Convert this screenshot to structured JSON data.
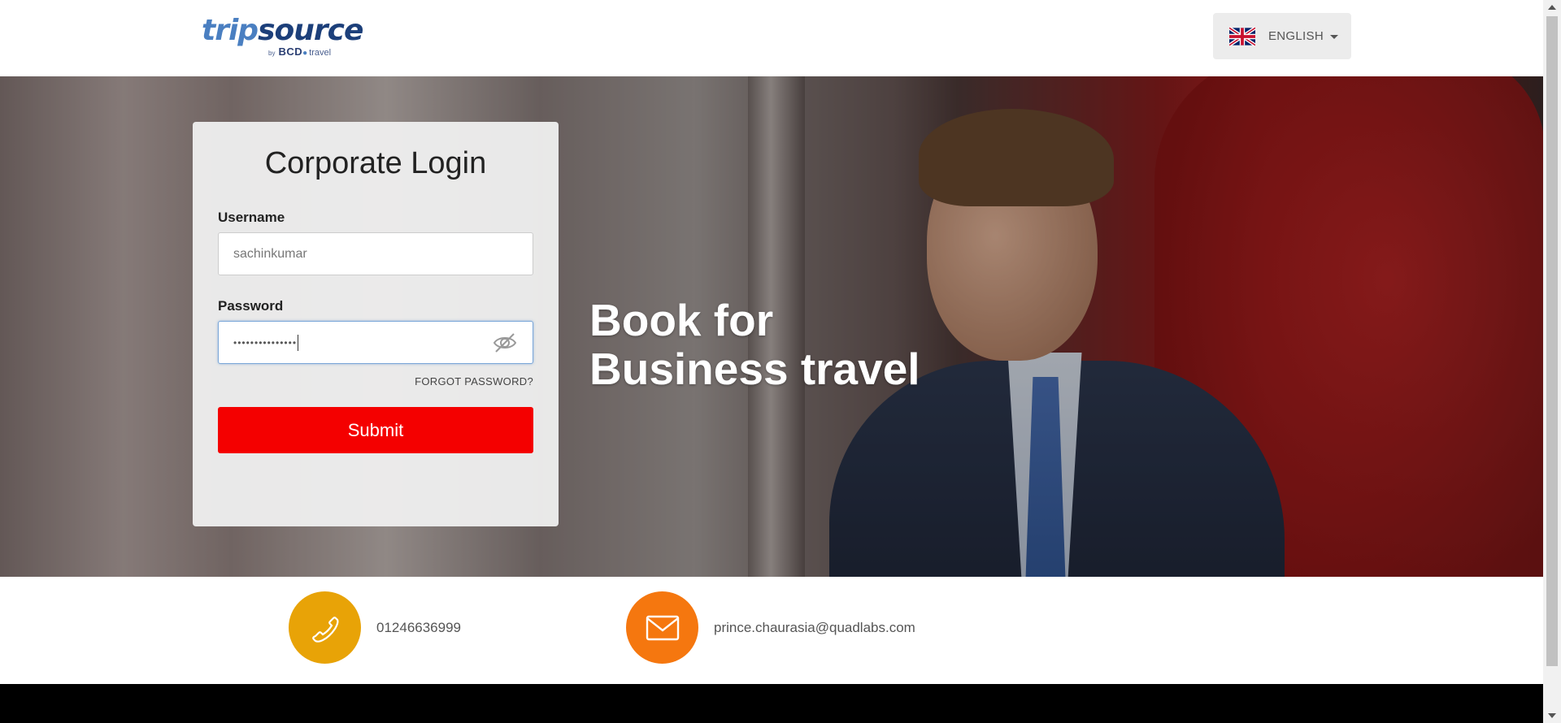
{
  "header": {
    "logo": {
      "part1": "trip",
      "part2": "source",
      "by": "by",
      "brand": "BCD",
      "brand_suffix": "travel"
    },
    "language": {
      "label": "ENGLISH",
      "flag": "uk-flag-icon"
    }
  },
  "login": {
    "title": "Corporate Login",
    "username_label": "Username",
    "username_value": "sachinkumar",
    "password_label": "Password",
    "password_value": "•••••••••••••••",
    "forgot_label": "FORGOT PASSWORD?",
    "submit_label": "Submit"
  },
  "hero": {
    "tagline_line1": "Book for",
    "tagline_line2": "Business travel"
  },
  "contact": {
    "phone": "01246636999",
    "email": "prince.chaurasia@quadlabs.com"
  },
  "colors": {
    "submit": "#f40000",
    "phone_circle": "#e8a307",
    "mail_circle": "#f5770f"
  }
}
